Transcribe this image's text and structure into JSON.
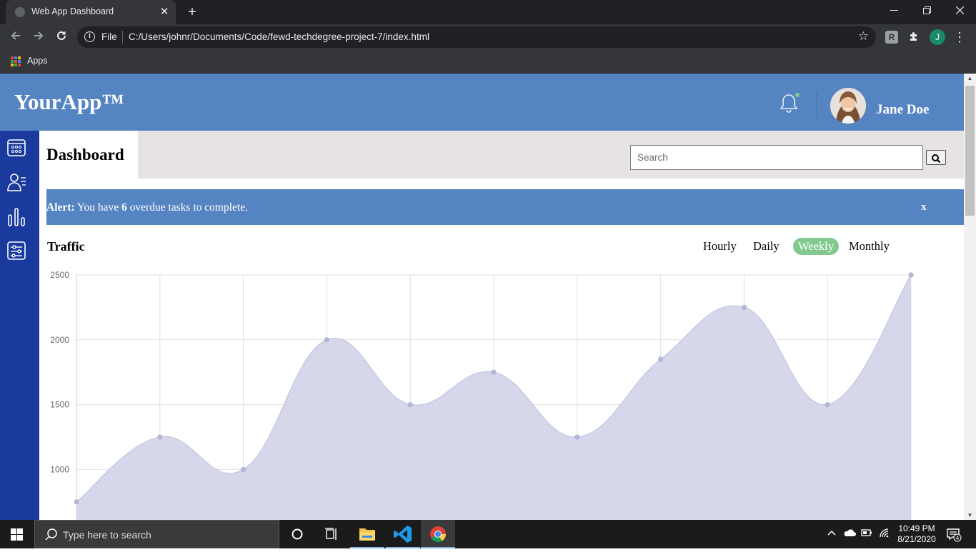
{
  "browser": {
    "tab_title": "Web App Dashboard",
    "close_glyph": "✕",
    "new_tab_glyph": "+",
    "scheme_label": "File",
    "url": "C:/Users/johnr/Documents/Code/fewd-techdegree-project-7/index.html",
    "profile_initial": "J",
    "bookmarks": {
      "apps_label": "Apps"
    }
  },
  "header": {
    "logo": "YourApp™",
    "user_name": "Jane Doe"
  },
  "subheader": {
    "title": "Dashboard",
    "search_placeholder": "Search"
  },
  "alert": {
    "label": "Alert:",
    "text_before": " You have ",
    "count": "6",
    "text_after": " overdue tasks to complete.",
    "close": "x"
  },
  "traffic": {
    "title": "Traffic",
    "filters": [
      "Hourly",
      "Daily",
      "Weekly",
      "Monthly"
    ],
    "active_filter": "Weekly"
  },
  "chart_data": {
    "type": "area",
    "title": "",
    "xlabel": "",
    "ylabel": "",
    "x": [
      1,
      2,
      3,
      4,
      5,
      6,
      7,
      8,
      9,
      10,
      11
    ],
    "values": [
      750,
      1250,
      1000,
      2000,
      1500,
      1750,
      1250,
      1850,
      2250,
      1500,
      2500
    ],
    "y_ticks": [
      1000,
      1500,
      2000,
      2500
    ],
    "grid": true,
    "fill_color": "#d5d5ea",
    "line_color": "#c9c9e3",
    "point_color": "#b9b9d8"
  },
  "colors": {
    "brand": "#5584c2",
    "sidebar": "#1a3a9e",
    "accent": "#81c98f"
  },
  "taskbar": {
    "search_placeholder": "Type here to search",
    "time": "10:49 PM",
    "date": "8/21/2020",
    "notification_count": "4"
  }
}
